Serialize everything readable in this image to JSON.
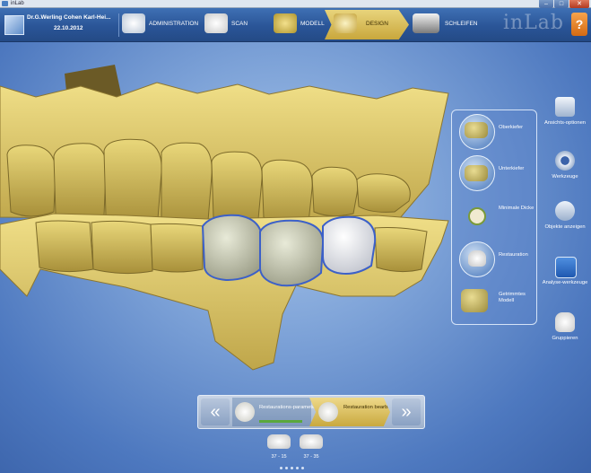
{
  "window": {
    "title": "inLab",
    "controls": [
      "minimize",
      "maximize",
      "close"
    ]
  },
  "patient": {
    "name": "Dr.G.Werling Cohen Karl-Hei...",
    "date": "22.10.2012"
  },
  "phases": [
    {
      "label": "ADMINISTRATION",
      "icon": "administration-icon"
    },
    {
      "label": "SCAN",
      "icon": "scan-icon"
    },
    {
      "label": "MODELL",
      "icon": "model-icon"
    },
    {
      "label": "DESIGN",
      "icon": "design-icon",
      "active": true
    },
    {
      "label": "SCHLEIFEN",
      "icon": "mill-icon"
    }
  ],
  "brand": "inLab",
  "help_label": "?",
  "model_panel": [
    {
      "label": "Oberkiefer"
    },
    {
      "label": "Unterkiefer"
    },
    {
      "label": "Minimale Dicke"
    },
    {
      "label": "Restauration"
    },
    {
      "label": "Getrimmtes Modell"
    }
  ],
  "tools": [
    {
      "label": "Ansichts-optionen",
      "icon": "view-options-icon"
    },
    {
      "label": "Werkzeuge",
      "icon": "tools-icon"
    },
    {
      "label": "Objekte anzeigen",
      "icon": "show-objects-icon"
    },
    {
      "label": "Analyse-werkzeuge",
      "icon": "analysis-tools-icon"
    },
    {
      "label": "Gruppieren",
      "icon": "group-icon"
    }
  ],
  "workflow": {
    "prev_label": "«",
    "next_label": "»",
    "steps": [
      {
        "label": "Restaurations-parameter"
      },
      {
        "label": "Restauration bearbeiten",
        "active": true
      }
    ]
  },
  "restorations": [
    {
      "label": "37 - 15"
    },
    {
      "label": "37 - 35"
    }
  ],
  "colors": {
    "accent_gold": "#d2b44c",
    "bar_blue": "#2a5597",
    "stone_yellow": "#e3cf72"
  }
}
